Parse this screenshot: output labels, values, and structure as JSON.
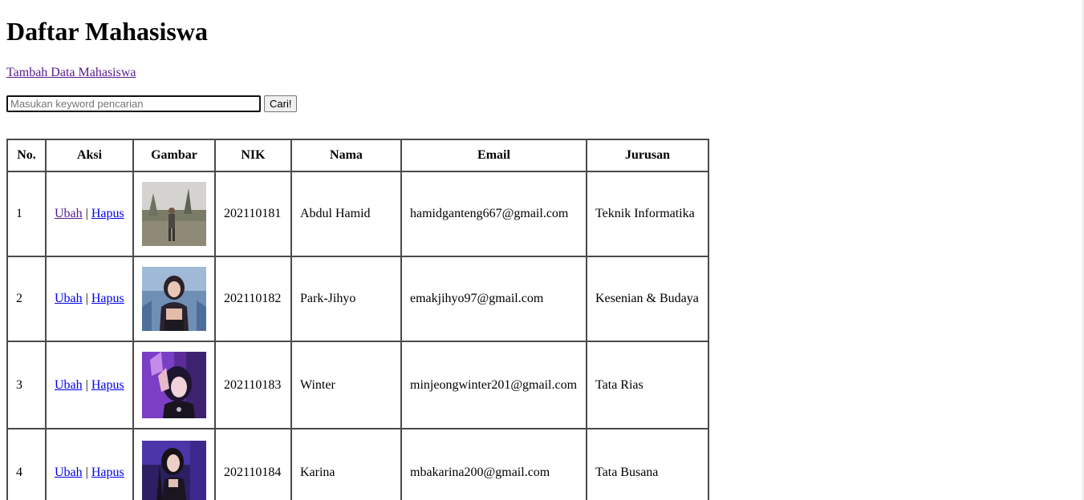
{
  "page": {
    "title": "Daftar Mahasiswa",
    "add_link": "Tambah Data Mahasiswa"
  },
  "search": {
    "placeholder": "Masukan keyword pencarian",
    "value": "",
    "button_label": "Cari!"
  },
  "table": {
    "headers": [
      "No.",
      "Aksi",
      "Gambar",
      "NIK",
      "Nama",
      "Email",
      "Jurusan"
    ],
    "rows": [
      {
        "no": "1",
        "edit_label": "Ubah",
        "separator": "|",
        "delete_label": "Hapus",
        "nik": "202110181",
        "nama": "Abdul Hamid",
        "email": "hamidganteng667@gmail.com",
        "jurusan": "Teknik Informatika"
      },
      {
        "no": "2",
        "edit_label": "Ubah",
        "separator": "|",
        "delete_label": "Hapus",
        "nik": "202110182",
        "nama": "Park-Jihyo",
        "email": "emakjihyo97@gmail.com",
        "jurusan": "Kesenian & Budaya"
      },
      {
        "no": "3",
        "edit_label": "Ubah",
        "separator": "|",
        "delete_label": "Hapus",
        "nik": "202110183",
        "nama": "Winter",
        "email": "minjeongwinter201@gmail.com",
        "jurusan": "Tata Rias"
      },
      {
        "no": "4",
        "edit_label": "Ubah",
        "separator": "|",
        "delete_label": "Hapus",
        "nik": "202110184",
        "nama": "Karina",
        "email": "mbakarina200@gmail.com",
        "jurusan": "Tata Busana"
      }
    ]
  },
  "colors": {
    "link": "#0000ee",
    "visited_link": "#551a8b",
    "table_border": "#4a4a4a"
  }
}
